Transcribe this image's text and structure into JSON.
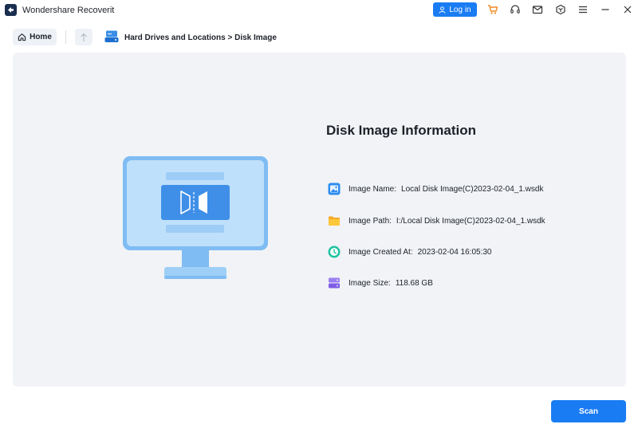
{
  "app": {
    "title": "Wondershare Recoverit"
  },
  "titlebar": {
    "login_label": "Log in",
    "icons": [
      "cart-icon",
      "headset-icon",
      "mail-icon",
      "settings-hexagon-icon",
      "menu-icon",
      "minimize-icon",
      "close-icon"
    ]
  },
  "nav": {
    "home_label": "Home",
    "breadcrumb": "Hard Drives and Locations > Disk Image"
  },
  "info": {
    "title": "Disk Image Information",
    "name_label": "Image Name:",
    "name_value": "Local Disk Image(C)2023-02-04_1.wsdk",
    "path_label": "Image Path:",
    "path_value": "I:/Local Disk Image(C)2023-02-04_1.wsdk",
    "created_label": "Image Created At:",
    "created_value": "2023-02-04 16:05:30",
    "size_label": "Image Size:",
    "size_value": "118.68 GB"
  },
  "actions": {
    "scan_label": "Scan"
  },
  "colors": {
    "accent": "#1a7cf3",
    "panel": "#f1f3f6",
    "text": "#1d2129"
  }
}
